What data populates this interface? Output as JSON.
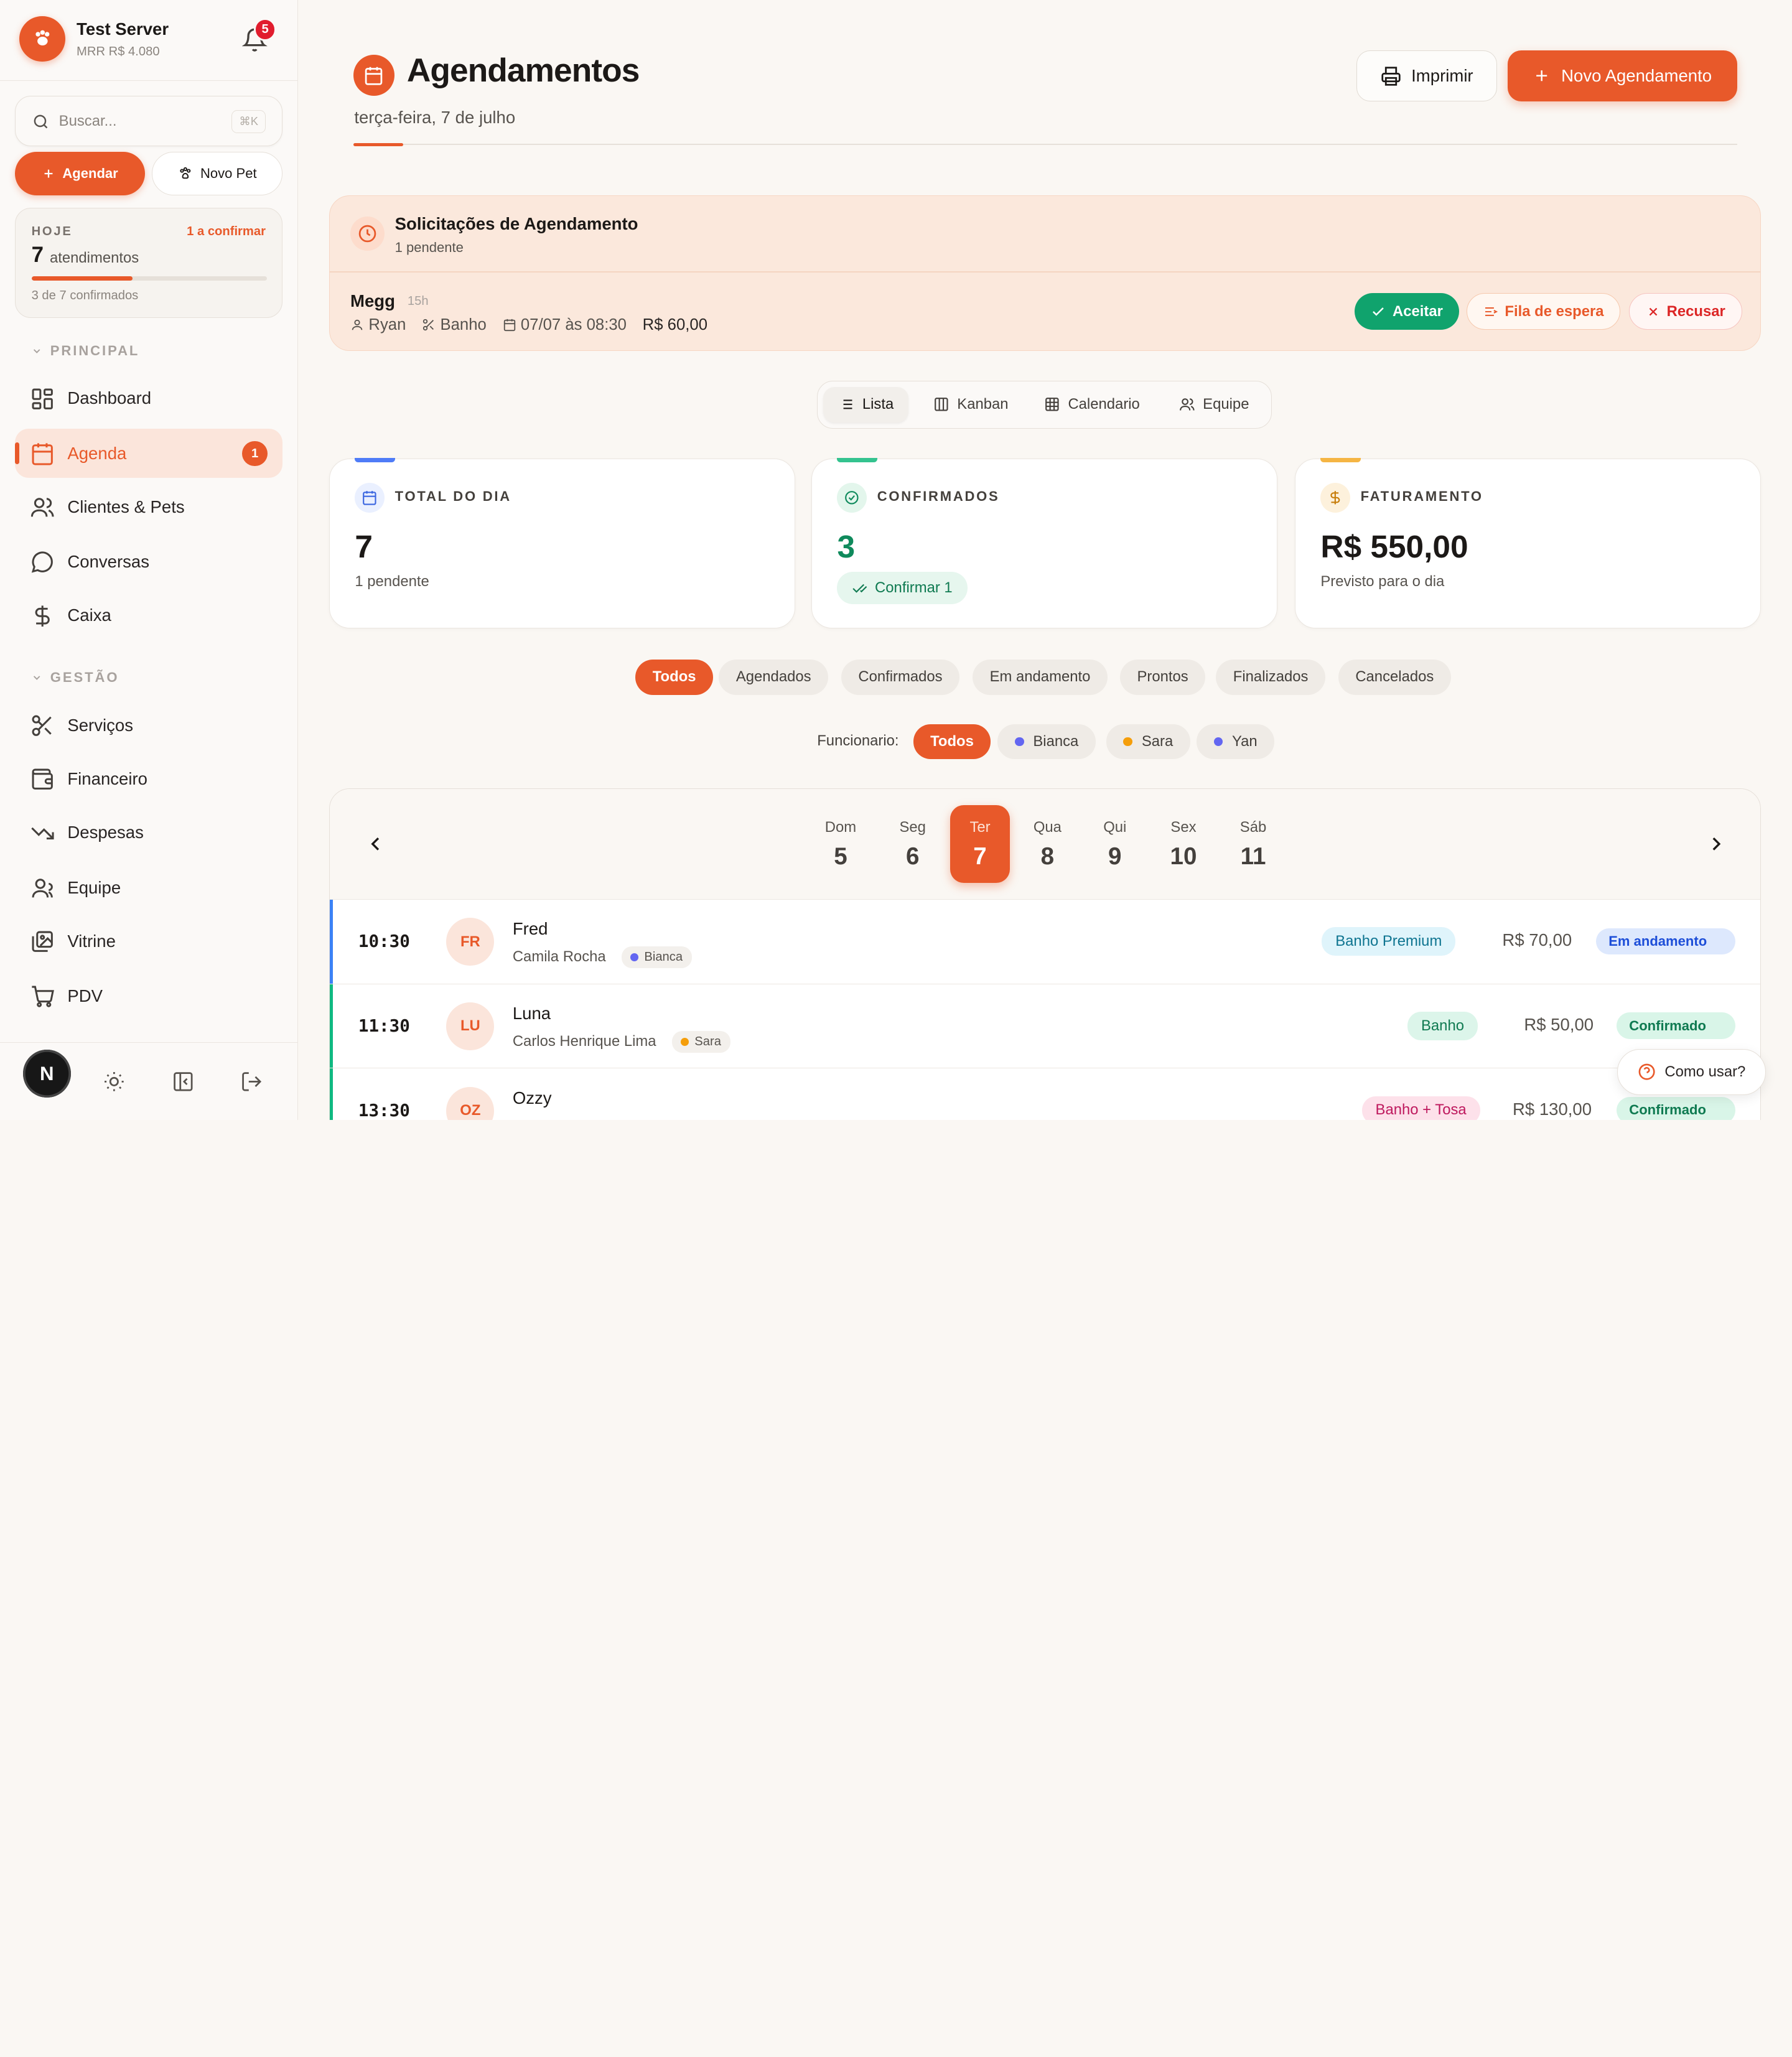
{
  "sidebar": {
    "server_name": "Test Server",
    "server_mrr": "MRR R$ 4.080",
    "notifications_count": "5",
    "search_placeholder": "Buscar...",
    "search_shortcut": "⌘K",
    "btn_agendar": "Agendar",
    "btn_novo_pet": "Novo Pet",
    "today": {
      "label": "HOJE",
      "pending": "1 a confirmar",
      "count": "7",
      "count_label": "atendimentos",
      "confirmed_text": "3 de 7 confirmados",
      "progress": 0.43
    },
    "section_principal": "PRINCIPAL",
    "section_gestao": "GESTÃO",
    "items": [
      {
        "label": "Dashboard",
        "icon": "dashboard-icon"
      },
      {
        "label": "Agenda",
        "icon": "calendar-icon",
        "badge": "1"
      },
      {
        "label": "Clientes & Pets",
        "icon": "users-icon"
      },
      {
        "label": "Conversas",
        "icon": "chat-icon"
      },
      {
        "label": "Caixa",
        "icon": "dollar-icon"
      },
      {
        "label": "Serviços",
        "icon": "scissors-icon"
      },
      {
        "label": "Financeiro",
        "icon": "wallet-icon"
      },
      {
        "label": "Despesas",
        "icon": "trending-down-icon"
      },
      {
        "label": "Equipe",
        "icon": "team-icon"
      },
      {
        "label": "Vitrine",
        "icon": "gallery-icon"
      },
      {
        "label": "PDV",
        "icon": "cart-icon"
      }
    ],
    "footer_avatar": "N"
  },
  "header": {
    "title": "Agendamentos",
    "date": "terça-feira, 7 de julho",
    "btn_print": "Imprimir",
    "btn_new": "Novo Agendamento"
  },
  "requests": {
    "title": "Solicitações de Agendamento",
    "subtitle": "1 pendente",
    "item": {
      "pet": "Megg",
      "ago": "15h",
      "owner": "Ryan",
      "service": "Banho",
      "datetime": "07/07 às 08:30",
      "price": "R$ 60,00"
    },
    "btn_accept": "Aceitar",
    "btn_waitlist": "Fila de espera",
    "btn_refuse": "Recusar"
  },
  "views": [
    "Lista",
    "Kanban",
    "Calendario",
    "Equipe"
  ],
  "stats": {
    "total": {
      "label": "TOTAL DO DIA",
      "value": "7",
      "sub": "1 pendente"
    },
    "confirmed": {
      "label": "CONFIRMADOS",
      "value": "3",
      "action": "Confirmar 1"
    },
    "revenue": {
      "label": "FATURAMENTO",
      "value": "R$ 550,00",
      "sub": "Previsto para o dia"
    }
  },
  "filters": [
    "Todos",
    "Agendados",
    "Confirmados",
    "Em andamento",
    "Prontos",
    "Finalizados",
    "Cancelados"
  ],
  "employees": {
    "label": "Funcionario:",
    "items": [
      {
        "name": "Todos",
        "color": ""
      },
      {
        "name": "Bianca",
        "color": "#6366f1"
      },
      {
        "name": "Sara",
        "color": "#f59e0b"
      },
      {
        "name": "Yan",
        "color": "#6366f1"
      }
    ]
  },
  "week": [
    {
      "name": "Dom",
      "day": "5"
    },
    {
      "name": "Seg",
      "day": "6"
    },
    {
      "name": "Ter",
      "day": "7"
    },
    {
      "name": "Qua",
      "day": "8"
    },
    {
      "name": "Qui",
      "day": "9"
    },
    {
      "name": "Sex",
      "day": "10"
    },
    {
      "name": "Sáb",
      "day": "11"
    }
  ],
  "appointments": [
    {
      "time": "10:30",
      "initials": "FR",
      "pet": "Fred",
      "owner": "Camila Rocha",
      "employee": "Bianca",
      "employee_color": "#6366f1",
      "service": "Banho Premium",
      "price": "R$ 70,00",
      "status": "Em andamento",
      "bar_color": "#3b82f6"
    },
    {
      "time": "11:30",
      "initials": "LU",
      "pet": "Luna",
      "owner": "Carlos Henrique Lima",
      "employee": "Sara",
      "employee_color": "#f59e0b",
      "service": "Banho",
      "price": "R$ 50,00",
      "status": "Confirmado",
      "bar_color": "#10b981"
    },
    {
      "time": "13:30",
      "initials": "OZ",
      "pet": "Ozzy",
      "owner": "",
      "employee": "",
      "employee_color": "",
      "service": "Banho + Tosa",
      "price": "R$ 130,00",
      "status": "Confirmado",
      "bar_color": "#10b981"
    }
  ],
  "help": "Como usar?",
  "colors": {
    "accent": "#e8592a",
    "success": "#10a36d",
    "danger": "#dc2626"
  }
}
